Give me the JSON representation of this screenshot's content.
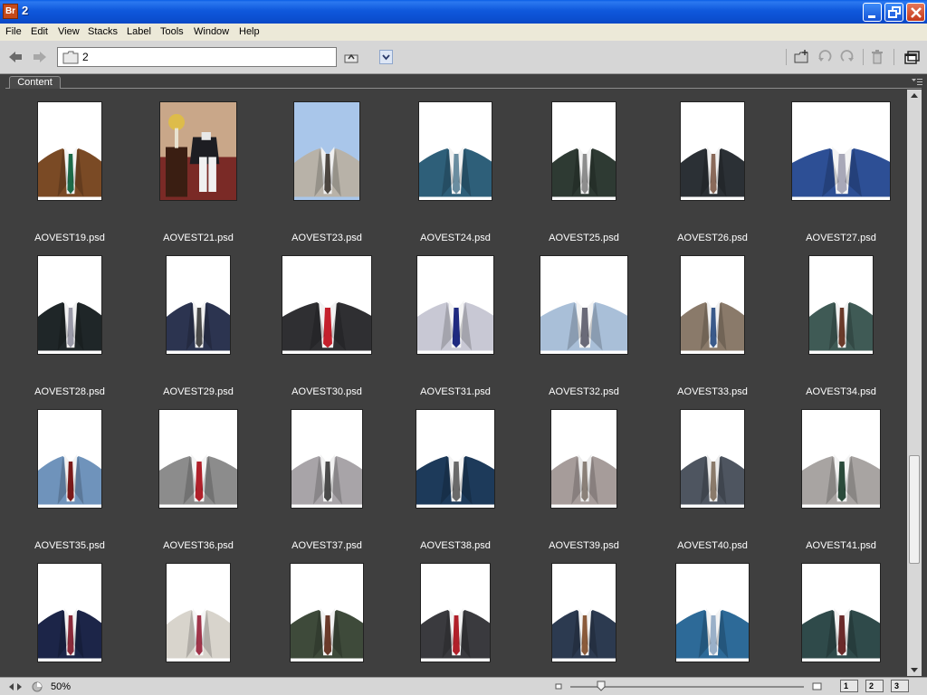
{
  "window": {
    "title": "2",
    "app_icon_text": "Br"
  },
  "menu": [
    "File",
    "Edit",
    "View",
    "Stacks",
    "Label",
    "Tools",
    "Window",
    "Help"
  ],
  "path": {
    "current_folder": "2"
  },
  "panel": {
    "tab_label": "Content"
  },
  "status": {
    "zoom": "50%",
    "zoom_fraction": 0.13,
    "view_buttons": [
      "1",
      "2",
      "3"
    ]
  },
  "colors": {
    "title_bar": "#0b4fd0",
    "panel_bg": "#3f3f3f",
    "toolbar_bg": "#d6d6d6"
  },
  "files": [
    {
      "name": "AOVEST19.psd",
      "bg": "#ffffff",
      "suit": "#7a4a25",
      "tie": "#1c6a48",
      "shirt": "#f4f4f4",
      "w": 72,
      "h": 110,
      "variant": "suit"
    },
    {
      "name": "AOVEST21.psd",
      "bg": "#caa98a",
      "suit": "#1d1d22",
      "tie": "#333",
      "shirt": "#ddd",
      "w": 86,
      "h": 110,
      "variant": "photo"
    },
    {
      "name": "AOVEST23.psd",
      "bg": "#a9c6ea",
      "suit": "#b8b2a8",
      "tie": "#4c4640",
      "shirt": "#f0f0f0",
      "w": 74,
      "h": 110,
      "variant": "suit"
    },
    {
      "name": "AOVEST24.psd",
      "bg": "#ffffff",
      "suit": "#2e5f79",
      "tie": "#6a8da0",
      "shirt": "#f2f2f2",
      "w": 82,
      "h": 110,
      "variant": "suit"
    },
    {
      "name": "AOVEST25.psd",
      "bg": "#ffffff",
      "suit": "#2e3a33",
      "tie": "#8d8d8d",
      "shirt": "#f2f2f2",
      "w": 72,
      "h": 110,
      "variant": "suit"
    },
    {
      "name": "AOVEST26.psd",
      "bg": "#ffffff",
      "suit": "#2b3035",
      "tie": "#8a6a5a",
      "shirt": "#f2f2f2",
      "w": 72,
      "h": 110,
      "variant": "suit"
    },
    {
      "name": "AOVEST27.psd",
      "bg": "#ffffff",
      "suit": "#2d4f95",
      "tie": "#a8a8b8",
      "shirt": "#f4f4f4",
      "w": 110,
      "h": 110,
      "variant": "suit"
    },
    {
      "name": "AOVEST28.psd",
      "bg": "#ffffff",
      "suit": "#1f2628",
      "tie": "#9a9aa8",
      "shirt": "#f2f2f2",
      "w": 72,
      "h": 110,
      "variant": "suit"
    },
    {
      "name": "AOVEST29.psd",
      "bg": "#ffffff",
      "suit": "#2c3450",
      "tie": "#4a4a4a",
      "shirt": "#f2f2f2",
      "w": 72,
      "h": 110,
      "variant": "suit"
    },
    {
      "name": "AOVEST30.psd",
      "bg": "#ffffff",
      "suit": "#2f2f32",
      "tie": "#c4202c",
      "shirt": "#f2f2f2",
      "w": 100,
      "h": 110,
      "variant": "suit"
    },
    {
      "name": "AOVEST31.psd",
      "bg": "#ffffff",
      "suit": "#c8c8d4",
      "tie": "#1f2a80",
      "shirt": "#f4f4f4",
      "w": 86,
      "h": 110,
      "variant": "suit"
    },
    {
      "name": "AOVEST32.psd",
      "bg": "#ffffff",
      "suit": "#a9bfd8",
      "tie": "#6a6a78",
      "shirt": "#f4f4f4",
      "w": 98,
      "h": 110,
      "variant": "suit"
    },
    {
      "name": "AOVEST33.psd",
      "bg": "#ffffff",
      "suit": "#8a7a6a",
      "tie": "#3a5a8a",
      "shirt": "#f2f2f2",
      "w": 72,
      "h": 110,
      "variant": "suit"
    },
    {
      "name": "AOVEST34.psd",
      "bg": "#ffffff",
      "suit": "#3f5a55",
      "tie": "#6a3a2a",
      "shirt": "#f2f2f2",
      "w": 72,
      "h": 110,
      "variant": "suit"
    },
    {
      "name": "AOVEST35.psd",
      "bg": "#ffffff",
      "suit": "#6f93bb",
      "tie": "#7a1a1a",
      "shirt": "#f2f2f2",
      "w": 72,
      "h": 110,
      "variant": "suit"
    },
    {
      "name": "AOVEST36.psd",
      "bg": "#ffffff",
      "suit": "#8c8c8c",
      "tie": "#b0202a",
      "shirt": "#f4f4f4",
      "w": 88,
      "h": 110,
      "variant": "suit"
    },
    {
      "name": "AOVEST37.psd",
      "bg": "#ffffff",
      "suit": "#a8a4a8",
      "tie": "#4a4a4a",
      "shirt": "#f2f2f2",
      "w": 80,
      "h": 110,
      "variant": "suit"
    },
    {
      "name": "AOVEST38.psd",
      "bg": "#ffffff",
      "suit": "#1d3a5a",
      "tie": "#6a6a6a",
      "shirt": "#f4f4f4",
      "w": 88,
      "h": 110,
      "variant": "suit"
    },
    {
      "name": "AOVEST39.psd",
      "bg": "#ffffff",
      "suit": "#a69c9a",
      "tie": "#8a8078",
      "shirt": "#ececec",
      "w": 74,
      "h": 110,
      "variant": "suit"
    },
    {
      "name": "AOVEST40.psd",
      "bg": "#ffffff",
      "suit": "#4e5560",
      "tie": "#8a7a6a",
      "shirt": "#ececec",
      "w": 72,
      "h": 110,
      "variant": "suit"
    },
    {
      "name": "AOVEST41.psd",
      "bg": "#ffffff",
      "suit": "#a8a4a2",
      "tie": "#2a4a3a",
      "shirt": "#f4f4f4",
      "w": 88,
      "h": 110,
      "variant": "suit"
    },
    {
      "name": "",
      "bg": "#ffffff",
      "suit": "#1c2548",
      "tie": "#8a2a3a",
      "shirt": "#f2f2f2",
      "w": 72,
      "h": 110,
      "variant": "suit"
    },
    {
      "name": "",
      "bg": "#ffffff",
      "suit": "#d8d4cc",
      "tie": "#a0344a",
      "shirt": "#f6f6f6",
      "w": 72,
      "h": 110,
      "variant": "suit"
    },
    {
      "name": "",
      "bg": "#ffffff",
      "suit": "#3e4a3a",
      "tie": "#6a3a2a",
      "shirt": "#f2f2f2",
      "w": 82,
      "h": 110,
      "variant": "suit"
    },
    {
      "name": "",
      "bg": "#ffffff",
      "suit": "#3a3a3e",
      "tie": "#b0202a",
      "shirt": "#f2f2f2",
      "w": 78,
      "h": 110,
      "variant": "suit"
    },
    {
      "name": "",
      "bg": "#ffffff",
      "suit": "#2c3a50",
      "tie": "#8a5a3a",
      "shirt": "#f2f2f2",
      "w": 72,
      "h": 110,
      "variant": "suit"
    },
    {
      "name": "",
      "bg": "#ffffff",
      "suit": "#2d6a98",
      "tie": "#9ab0c8",
      "shirt": "#f4f4f4",
      "w": 82,
      "h": 110,
      "variant": "suit"
    },
    {
      "name": "",
      "bg": "#ffffff",
      "suit": "#2f4a4a",
      "tie": "#6a2a2a",
      "shirt": "#f2f2f2",
      "w": 88,
      "h": 110,
      "variant": "suit"
    }
  ]
}
